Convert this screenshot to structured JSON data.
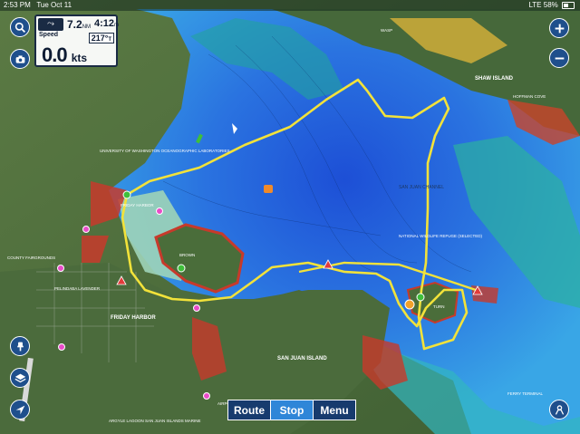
{
  "status_bar": {
    "time": "2:53 PM",
    "date": "Tue Oct 11",
    "network": "LTE",
    "battery": "58%"
  },
  "instrument_panel": {
    "distance_value": "7.2",
    "distance_unit": "NM",
    "eta_value": "4:12",
    "eta_unit": "m",
    "speed_label": "Speed",
    "heading": "217°",
    "heading_ref": "T",
    "speed_value": "0.0",
    "speed_unit": "kts"
  },
  "map_labels": {
    "friday_harbor": "FRIDAY HARBOR",
    "friday_harbor_water": "FRIDAY HARBOR",
    "shaw_island": "SHAW ISLAND",
    "san_juan_island": "SAN JUAN ISLAND",
    "brown_island": "BROWN",
    "turn_island": "TURN",
    "san_juan_channel": "SAN JUAN CHANNEL",
    "wildlife_refuge": "NATIONAL WILDLIFE REFUGE (SELECTED)",
    "uw_labs": "UNIVERSITY OF WASHINGTON OCEANOGRAPHIC LABORATORIES",
    "county_fairgrounds": "COUNTY FAIRGROUNDS",
    "argyle_lagoon": "ARGYLE LAGOON SAN JUAN ISLANDS MARINE",
    "hoffman_cove": "HOFFMAN COVE",
    "wasp": "WASP",
    "pelindaba": "PELINDABA LAVENDER",
    "airport_fish": "AIRPORT FISH",
    "ferry_terminal": "FERRY TERMINAL"
  },
  "toolbar": {
    "route_label": "Route",
    "stop_label": "Stop",
    "menu_label": "Menu"
  },
  "colors": {
    "panel_border": "#1a2b44",
    "button_blue": "#1f4f8c",
    "stop_active": "#2f86d8",
    "track_yellow": "#f2e23a"
  },
  "icons": {
    "search": "search-icon",
    "camera": "camera-icon",
    "zoom_in": "plus-icon",
    "zoom_out": "minus-icon",
    "pin": "pin-icon",
    "layers": "layers-icon",
    "locate": "location-arrow-icon",
    "account": "person-icon"
  }
}
